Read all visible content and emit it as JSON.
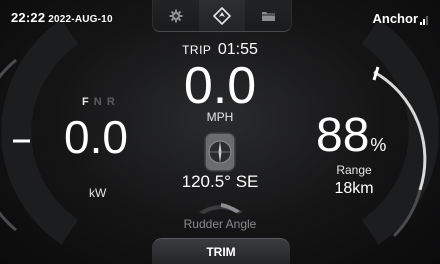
{
  "status": {
    "time": "22:22",
    "date": "2022-AUG-10",
    "mode_label": "Anchor"
  },
  "tabs": [
    {
      "icon": "gear-icon"
    },
    {
      "icon": "navigation-arrow-icon",
      "active": true
    },
    {
      "icon": "folder-icon"
    }
  ],
  "trip": {
    "label": "TRIP",
    "value": "01:55"
  },
  "speed": {
    "value": "0.0",
    "unit": "MPH"
  },
  "heading": {
    "value": "120.5° SE"
  },
  "rudder": {
    "label": "Rudder Angle"
  },
  "trim": {
    "label": "TRIM"
  },
  "gear": {
    "f": "F",
    "n": "N",
    "r": "R",
    "selected": "F"
  },
  "power": {
    "value": "0.0",
    "unit": "kW"
  },
  "battery": {
    "value": "88",
    "unit": "%",
    "level": 0.88,
    "range_label": "Range",
    "range_value": "18km"
  },
  "colors": {
    "accent": "#ffffff",
    "arc": "#d9d9d9",
    "dim": "#5c5d60"
  }
}
